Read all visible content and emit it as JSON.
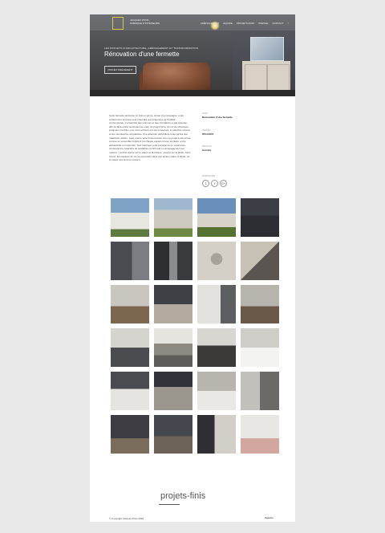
{
  "brand": {
    "line1": "JACQUES PONS",
    "line2": "FABRIQUE D'INTÉRIEURS"
  },
  "nav": [
    "AMÉNAGEMENT",
    "ÉQUIPE",
    "PROJETS FINIS",
    "PRESSE",
    "CONTACT",
    "f"
  ],
  "hero": {
    "kicker": "LES PROJETS D'ARCHITECTURE, AMÉNAGEMENT ET TRANSFORMATION",
    "title": "Rénovation d'une fermette",
    "prev_label": "PROJET PRÉCÉDENT"
  },
  "description": "Cette fermette ancienne en bois et pierre, située à la campagne, a été entièrement rénovée pour répondre aux exigences de l'habitat contemporain. L'ensemble des volumes et des circulations a été repensé afin de faire entrer la lumière au cœur du programme, du rez-de-chaussée jusqu'aux combles. Les murs anciens ont été conservés, le plancher rénové et les menuiseries remplacées. Une attention particulière a été portée aux matériaux nobles : bois, pierre, acier brut et béton ciré. Le projet a été pensé comme un ensemble cohérent où chaque espace trouve sa place, entre authenticité et modernité. Tout l'intérieur a été transformé en cohérence, conservant le caractère de la bâtisse, enrichi par un aménagement sur mesure. L'entrée donne sur le séjour et la cuisine, ouverts sur le jardin. Ainsi réunis, les espaces de vie se répondent dans une lecture claire et fluide, où le passé rencontre le présent.",
  "meta": [
    {
      "label": "NOM",
      "value": "Rénovation d'une fermette"
    },
    {
      "label": "ANNÉE",
      "value": "2014-2015"
    },
    {
      "label": "RÉGION",
      "value": "Corrèze"
    }
  ],
  "share": {
    "label": "PARTAGER",
    "icons": [
      "𝕥",
      "f",
      "G+"
    ]
  },
  "footer": {
    "title": "projets-finis",
    "copyright": "© Copyright Jacques Pons 2016",
    "logo": "Agence"
  }
}
